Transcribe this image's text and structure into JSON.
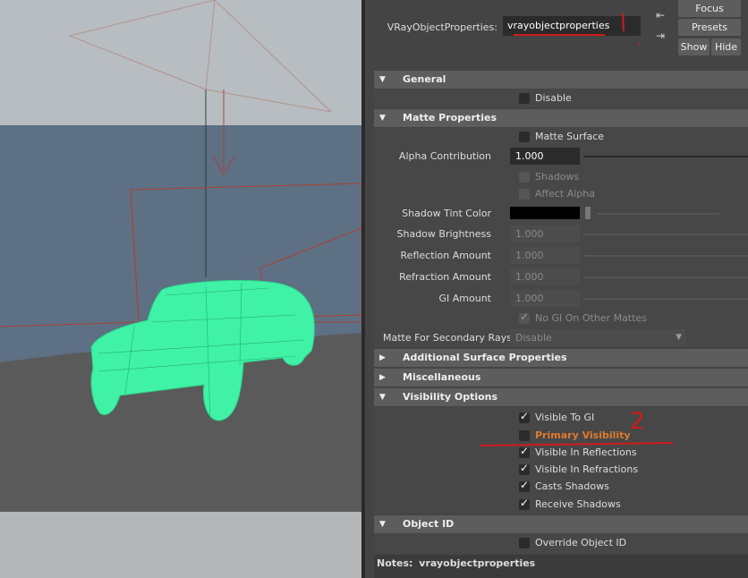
{
  "node": {
    "label": "VRayObjectProperties:",
    "value": "vrayobjectproperties"
  },
  "buttons": {
    "focus": "Focus",
    "presets": "Presets",
    "show": "Show",
    "hide": "Hide"
  },
  "sections": {
    "general": {
      "title": "General",
      "disable": {
        "label": "Disable",
        "checked": false
      }
    },
    "matte": {
      "title": "Matte Properties",
      "matte_surface": {
        "label": "Matte Surface",
        "checked": false
      },
      "alpha_contribution": {
        "label": "Alpha Contribution",
        "value": "1.000"
      },
      "shadows": {
        "label": "Shadows",
        "checked": false
      },
      "affect_alpha": {
        "label": "Affect Alpha",
        "checked": false
      },
      "shadow_tint_color": {
        "label": "Shadow Tint Color",
        "color": "#000000"
      },
      "shadow_brightness": {
        "label": "Shadow Brightness",
        "value": "1.000"
      },
      "reflection_amount": {
        "label": "Reflection Amount",
        "value": "1.000"
      },
      "refraction_amount": {
        "label": "Refraction Amount",
        "value": "1.000"
      },
      "gi_amount": {
        "label": "GI Amount",
        "value": "1.000"
      },
      "no_gi_on_other_mattes": {
        "label": "No GI On Other Mattes",
        "checked": true
      },
      "matte_secondary_rays": {
        "label": "Matte For Secondary Rays",
        "value": "Disable"
      }
    },
    "additional": {
      "title": "Additional Surface Properties"
    },
    "misc": {
      "title": "Miscellaneous"
    },
    "visibility": {
      "title": "Visibility Options",
      "visible_to_gi": {
        "label": "Visible To GI",
        "checked": true
      },
      "primary_visibility": {
        "label": "Primary Visibility",
        "checked": false
      },
      "visible_in_reflections": {
        "label": "Visible In Reflections",
        "checked": true
      },
      "visible_in_refractions": {
        "label": "Visible In Refractions",
        "checked": true
      },
      "casts_shadows": {
        "label": "Casts Shadows",
        "checked": true
      },
      "receive_shadows": {
        "label": "Receive Shadows",
        "checked": true
      },
      "annotation": "2"
    },
    "object_id": {
      "title": "Object ID",
      "override_object_id": {
        "label": "Override Object ID",
        "checked": false
      }
    }
  },
  "notes": {
    "label": "Notes:",
    "value": "vrayobjectproperties"
  },
  "colors": {
    "mesh": "#3ff2a6",
    "camera_lines": "#b33b2b",
    "annotation_red": "#d11a1a",
    "highlight_orange": "#e07a2c"
  },
  "icons": {
    "copy_tab": "copy-tab-icon",
    "load_selected": "load-selected-icon"
  }
}
